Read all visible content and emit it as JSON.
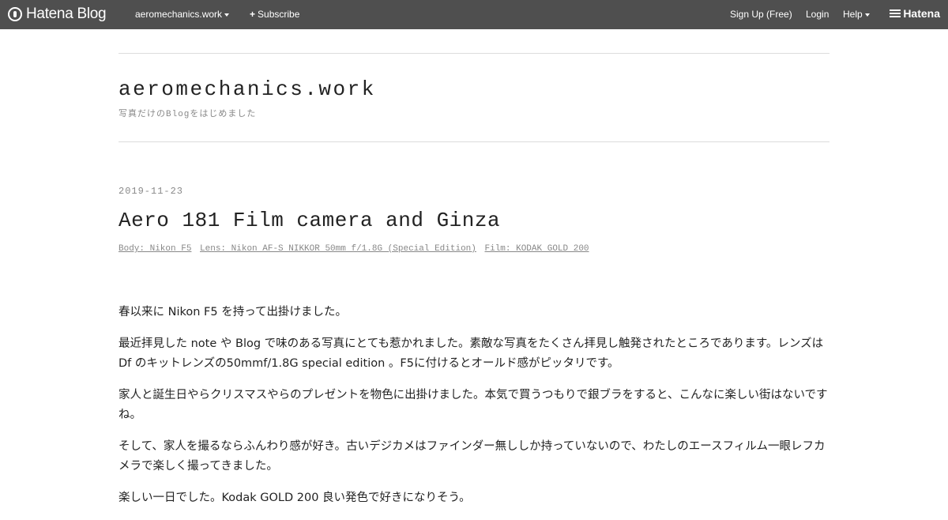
{
  "topbar": {
    "brand": "Hatena Blog",
    "blog_menu": "aeromechanics.work",
    "subscribe": "Subscribe",
    "signup": "Sign Up (Free)",
    "login": "Login",
    "help": "Help",
    "hatena": "Hatena"
  },
  "blog": {
    "title": "aeromechanics.work",
    "description": "写真だけのBlogをはじめました"
  },
  "entry": {
    "date": "2019-11-23",
    "title": "Aero 181 Film camera and Ginza",
    "categories": [
      "Body: Nikon F5",
      "Lens: Nikon AF-S NIKKOR 50mm f/1.8G (Special Edition)",
      "Film: KODAK GOLD 200"
    ],
    "paragraphs": [
      "春以来に Nikon F5 を持って出掛けました。",
      "最近拝見した note や Blog で味のある写真にとても惹かれました。素敵な写真をたくさん拝見し触発されたところであります。レンズは Df のキットレンズの50mmf/1.8G special edition 。F5に付けるとオールド感がピッタリです。",
      "家人と誕生日やらクリスマスやらのプレゼントを物色に出掛けました。本気で買うつもりで銀ブラをすると、こんなに楽しい街はないですね。",
      "そして、家人を撮るならふんわり感が好き。古いデジカメはファインダー無ししか持っていないので、わたしのエースフィルム一眼レフカメラで楽しく撮ってきました。",
      "楽しい一日でした。Kodak GOLD 200 良い発色で好きになりそう。"
    ]
  }
}
